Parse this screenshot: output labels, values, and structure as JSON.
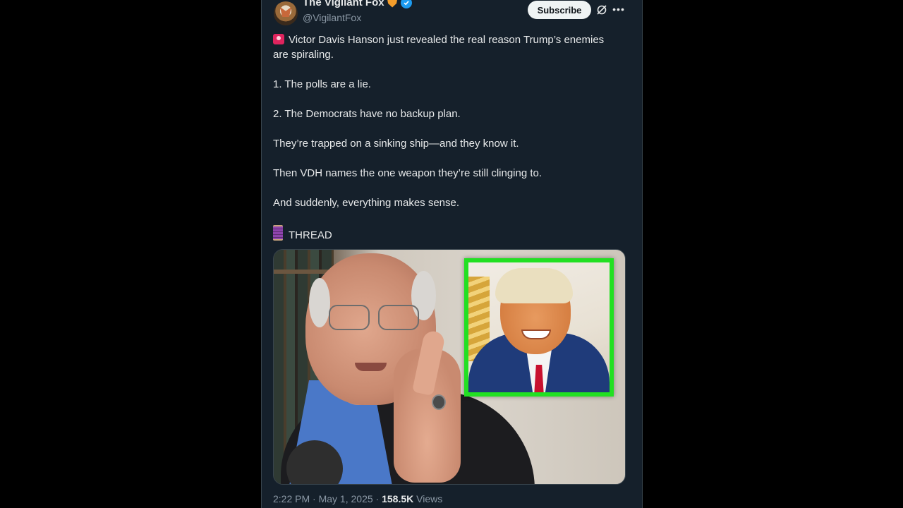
{
  "author": {
    "display_name": "The Vigilant Fox",
    "handle": "@VigilantFox",
    "subscribe_label": "Subscribe"
  },
  "icons": {
    "badge": "fox-emoji-icon",
    "verified": "verified-badge-icon",
    "grok": "grok-icon",
    "more": "more-icon",
    "siren": "siren-icon",
    "thread": "thread-icon"
  },
  "post": {
    "lines": [
      "Victor Davis Hanson just revealed the real reason Trump’s enemies are spiraling.",
      "1. The polls are a lie.",
      "2. The Democrats have no backup plan.",
      "They’re trapped on a sinking ship—and they know it.",
      "Then VDH names the one weapon they’re still clinging to.",
      "And suddenly, everything makes sense.",
      "THREAD"
    ]
  },
  "meta": {
    "time": "2:22 PM",
    "separator": "·",
    "date": "May 1, 2025",
    "views_count": "158.5K",
    "views_label": "Views"
  },
  "colors": {
    "background": "#15202b",
    "text": "#e7e9ea",
    "muted": "#8b98a5",
    "verified": "#1d9bf0",
    "inset_border": "#22e022"
  }
}
